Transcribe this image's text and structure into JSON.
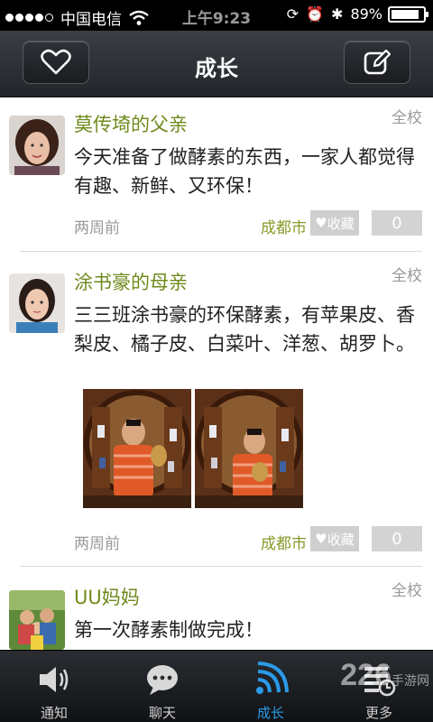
{
  "status": {
    "carrier": "中国电信",
    "time": "上午9:23",
    "battery": "89%",
    "battery_level": 0.89
  },
  "nav": {
    "title": "成长",
    "left_icon": "heart-icon",
    "right_icon": "compose-icon"
  },
  "posts": [
    {
      "author": "莫传埼的父亲",
      "scope": "全校",
      "content": "今天准备了做酵素的东西，一家人都觉得有趣、新鲜、又环保！",
      "time": "两周前",
      "location": "成都市",
      "fav_label": "收藏",
      "count": "0"
    },
    {
      "author": "涂书豪的母亲",
      "scope": "全校",
      "content": "三三班涂书豪的环保酵素，有苹果皮、香梨皮、橘子皮、白菜叶、洋葱、胡罗卜。",
      "time": "两周前",
      "location": "成都市",
      "fav_label": "收藏",
      "count": "0"
    },
    {
      "author": "UU妈妈",
      "scope": "全校",
      "content": "第一次酵素制做完成！"
    }
  ],
  "tabs": [
    {
      "label": "通知",
      "icon": "speaker-icon"
    },
    {
      "label": "聊天",
      "icon": "chat-bubble-icon"
    },
    {
      "label": "成长",
      "icon": "signal-icon",
      "active": true
    },
    {
      "label": "更多",
      "icon": "more-list-icon"
    }
  ],
  "watermark": {
    "main": "226",
    "sub": "手游网"
  },
  "colors": {
    "author": "#6f8a1c",
    "active_tab": "#2a9be8"
  }
}
